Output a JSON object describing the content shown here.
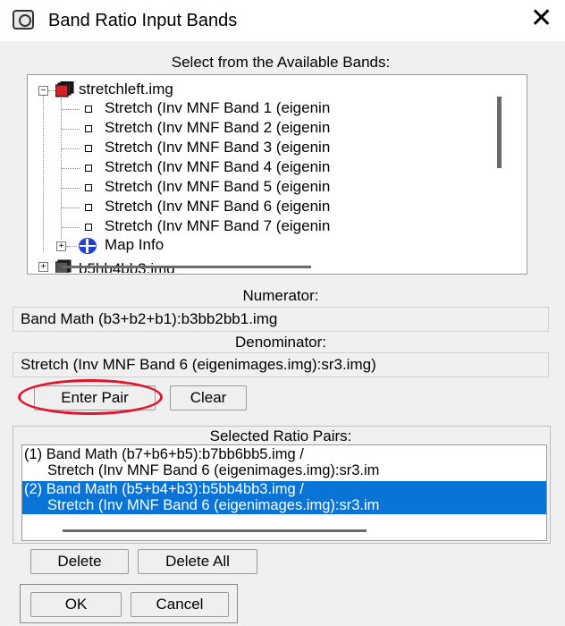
{
  "window": {
    "title": "Band Ratio Input Bands",
    "icon": "envi-app-icon",
    "close_glyph": "✕"
  },
  "bands_section": {
    "label": "Select from the Available Bands:",
    "file": "stretchleft.img",
    "bands": [
      "Stretch (Inv MNF Band 1 (eigenin",
      "Stretch (Inv MNF Band 2 (eigenin",
      "Stretch (Inv MNF Band 3 (eigenin",
      "Stretch (Inv MNF Band 4 (eigenin",
      "Stretch (Inv MNF Band 5 (eigenin",
      "Stretch (Inv MNF Band 6 (eigenin",
      "Stretch (Inv MNF Band 7 (eigenin"
    ],
    "map_info": "Map Info",
    "next_file_partial": "b5hb4bb3.img"
  },
  "numerator": {
    "label": "Numerator:",
    "value": "Band Math (b3+b2+b1):b3bb2bb1.img"
  },
  "denominator": {
    "label": "Denominator:",
    "value": "Stretch (Inv MNF Band 6 (eigenimages.img):sr3.img)"
  },
  "buttons": {
    "enter_pair": "Enter Pair",
    "clear": "Clear",
    "delete": "Delete",
    "delete_all": "Delete All",
    "ok": "OK",
    "cancel": "Cancel"
  },
  "pairs_section": {
    "label": "Selected Ratio Pairs:",
    "pairs": [
      {
        "line1": "(1) Band Math (b7+b6+b5):b7bb6bb5.img /",
        "line2": "Stretch (Inv MNF Band 6 (eigenimages.img):sr3.im",
        "selected": false
      },
      {
        "line1": "(2) Band Math (b5+b4+b3):b5bb4bb3.img /",
        "line2": "Stretch (Inv MNF Band 6 (eigenimages.img):sr3.im",
        "selected": true
      }
    ]
  },
  "colors": {
    "selection": "#0a74d6",
    "highlight_annotation": "#e2132b",
    "globe": "#1f3fd6"
  }
}
